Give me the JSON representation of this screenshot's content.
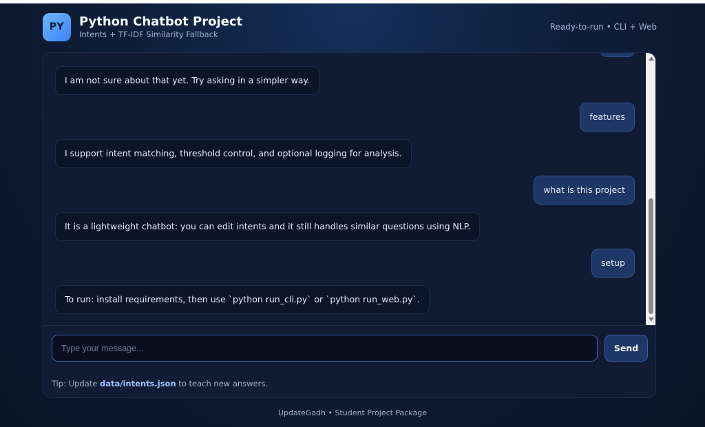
{
  "header": {
    "logo_text": "PY",
    "title": "Python Chatbot Project",
    "subtitle": "Intents + TF-IDF Similarity Fallback",
    "status": "Ready-to-run • CLI + Web"
  },
  "messages": [
    {
      "role": "bot",
      "text": "I am not sure about that yet. Try asking in a simpler way."
    },
    {
      "role": "user",
      "text": "features"
    },
    {
      "role": "bot",
      "text": "I support intent matching, threshold control, and optional logging for analysis."
    },
    {
      "role": "user",
      "text": "what is this project"
    },
    {
      "role": "bot",
      "text": "It is a lightweight chatbot: you can edit intents and it still handles similar questions using NLP."
    },
    {
      "role": "user",
      "text": "setup"
    },
    {
      "role": "bot",
      "text": "To run: install requirements, then use `python run_cli.py` or `python run_web.py`."
    }
  ],
  "composer": {
    "input_value": "",
    "placeholder": "Type your message...",
    "send_label": "Send"
  },
  "tip": {
    "prefix": "Tip: Update ",
    "file": "data/intents.json",
    "suffix": " to teach new answers."
  },
  "footer": {
    "text": "UpdateGadh • Student Project Package"
  },
  "colors": {
    "background": "#0e1e38",
    "card": "#111b33",
    "bot_bubble": "#0c1428",
    "user_bubble": "#1d3766",
    "accent": "#3b82f6",
    "tip_highlight": "#9cc4ff"
  },
  "icons": {
    "logo": "python-badge-icon",
    "scroll_up": "scroll-up-arrow-icon",
    "scroll_down": "scroll-down-arrow-icon"
  }
}
